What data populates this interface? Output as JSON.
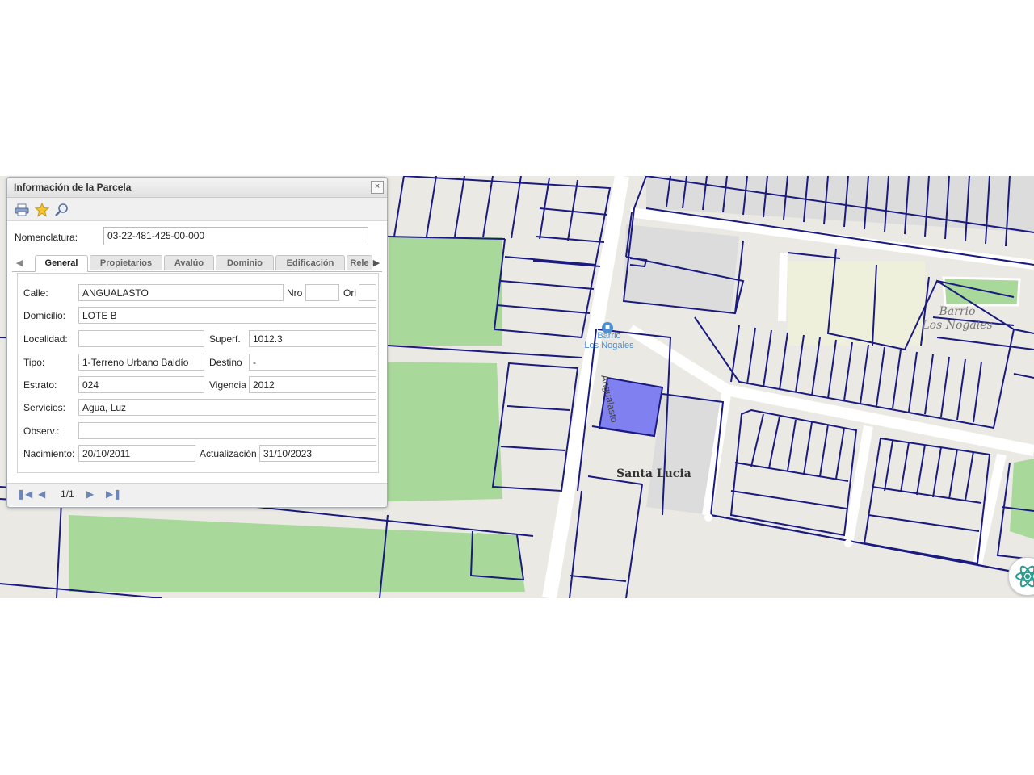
{
  "map": {
    "street_label": "Angualasto",
    "bus_stop_label_1": "Barrio",
    "bus_stop_label_2": "Los Nogales",
    "barrio_label_1": "Barrio",
    "barrio_label_2": "Los Nogales",
    "neighborhood_label": "Santa Lucia",
    "parcel_color": "#8080f0",
    "parcel_line_color": "#1a1a80",
    "park_color": "#a8d89a"
  },
  "panel": {
    "title": "Información de la Parcela",
    "close": "×",
    "nomenclatura_label": "Nomenclatura:",
    "nomenclatura_value": "03-22-481-425-00-000",
    "tabs": [
      "General",
      "Propietarios",
      "Avalúo",
      "Dominio",
      "Edificación",
      "Rele"
    ],
    "active_tab": "General",
    "fields": {
      "calle_label": "Calle:",
      "calle": "ANGUALASTO",
      "nro_label": "Nro",
      "nro": "",
      "ori_label": "Ori",
      "ori": "",
      "domicilio_label": "Domicilio:",
      "domicilio": "LOTE B",
      "localidad_label": "Localidad:",
      "localidad": "",
      "superf_label": "Superf.",
      "superf": "1012.3",
      "tipo_label": "Tipo:",
      "tipo": "1-Terreno Urbano Baldío",
      "destino_label": "Destino",
      "destino": "-",
      "estrato_label": "Estrato:",
      "estrato": "024",
      "vigencia_label": "Vigencia",
      "vigencia": "2012",
      "servicios_label": "Servicios:",
      "servicios": "Agua, Luz",
      "observ_label": "Observ.:",
      "observ": "",
      "nacimiento_label": "Nacimiento:",
      "nacimiento": "20/10/2011",
      "actualizacion_label": "Actualización",
      "actualizacion": "31/10/2023"
    },
    "pager": {
      "page": "1/1"
    }
  }
}
